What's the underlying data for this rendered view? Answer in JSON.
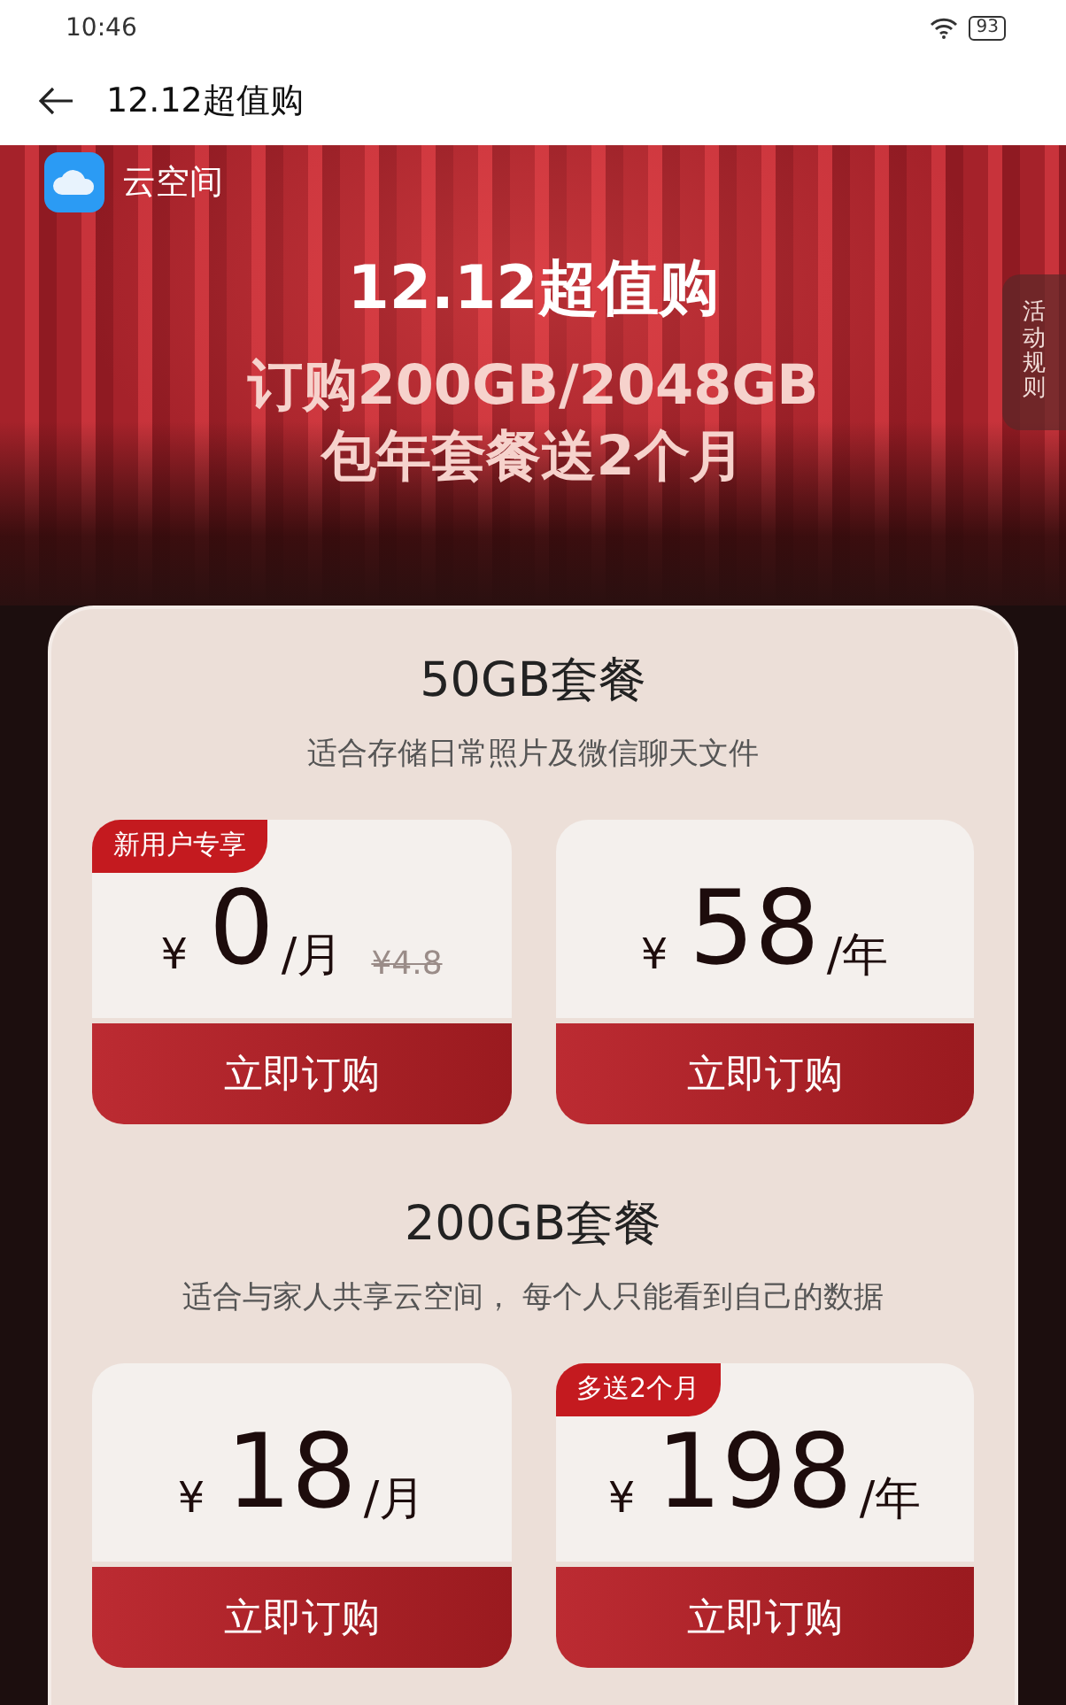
{
  "status_bar": {
    "time": "10:46",
    "battery": "93"
  },
  "header": {
    "title": "12.12超值购"
  },
  "banner": {
    "app_name": "云空间",
    "headline": "12.12超值购",
    "subline_1": "订购200GB/2048GB",
    "subline_2": "包年套餐送2个月",
    "rules_tab": "活动规则"
  },
  "plans": [
    {
      "name": "50GB套餐",
      "description": "适合存储日常照片及微信聊天文件",
      "offers": [
        {
          "badge": "新用户专享",
          "currency": "¥",
          "amount": "0",
          "unit": "/月",
          "original_price": "¥4.8",
          "button": "立即订购"
        },
        {
          "currency": "¥",
          "amount": "58",
          "unit": "/年",
          "button": "立即订购"
        }
      ]
    },
    {
      "name": "200GB套餐",
      "description": "适合与家人共享云空间， 每个人只能看到自己的数据",
      "offers": [
        {
          "currency": "¥",
          "amount": "18",
          "unit": "/月",
          "button": "立即订购"
        },
        {
          "badge": "多送2个月",
          "currency": "¥",
          "amount": "198",
          "unit": "/年",
          "button": "立即订购"
        }
      ]
    }
  ]
}
